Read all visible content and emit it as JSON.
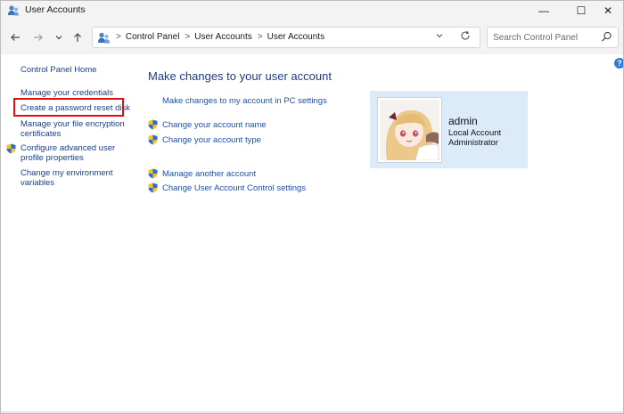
{
  "window": {
    "title": "User Accounts",
    "minimize_glyph": "—",
    "maximize_glyph": "☐",
    "close_glyph": "✕"
  },
  "toolbar": {
    "breadcrumbs": [
      "Control Panel",
      "User Accounts",
      "User Accounts"
    ],
    "search_placeholder": "Search Control Panel"
  },
  "left_pane": {
    "home": "Control Panel Home",
    "manage_credentials": "Manage your credentials",
    "password_reset": "Create a password reset disk",
    "file_encryption": "Manage your file encryption certificates",
    "advanced_profile": "Configure advanced user profile properties",
    "environment": "Change my environment variables"
  },
  "main": {
    "heading": "Make changes to your user account",
    "pc_settings": "Make changes to my account in PC settings",
    "change_name": "Change your account name",
    "change_type": "Change your account type",
    "manage_another": "Manage another account",
    "uac_settings": "Change User Account Control settings"
  },
  "account": {
    "name": "admin",
    "type": "Local Account",
    "role": "Administrator"
  },
  "icons": {
    "app": "user-accounts-icon",
    "shield": "uac-shield-icon",
    "help": "help-icon",
    "search": "search-icon"
  },
  "colors": {
    "link": "#1b4fb0",
    "heading": "#1e3b8c",
    "card": "#dcebf9",
    "highlight": "#e01010"
  }
}
